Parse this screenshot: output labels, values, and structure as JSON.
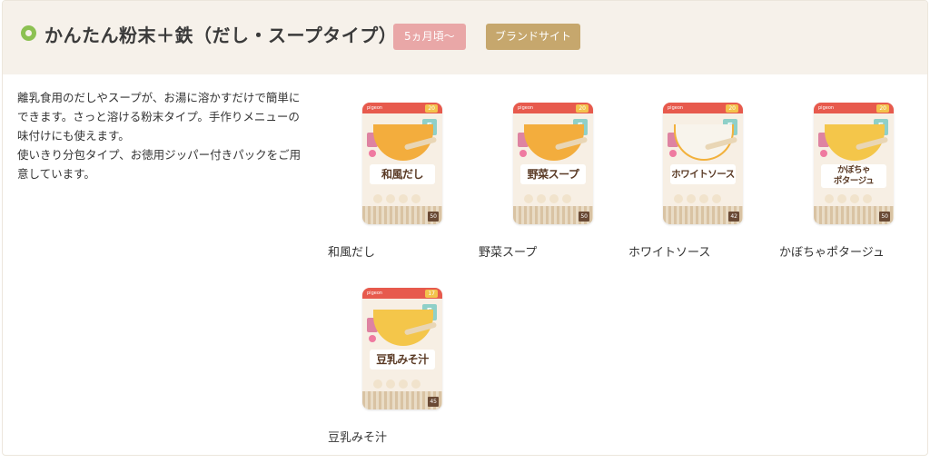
{
  "header": {
    "title": "かんたん粉末＋鉄（だし・スープタイプ）",
    "age_badge": "5ヵ月頃〜",
    "brand_button": "ブランドサイト"
  },
  "description": {
    "paragraph1": "離乳食用のだしやスープが、お湯に溶かすだけで簡単にできます。さっと溶ける粉末タイプ。手作りメニューの味付けにも使えます。",
    "paragraph2": "使いきり分包タイプ、お徳用ジッパー付きパックをご用意しています。"
  },
  "products": [
    {
      "name": "和風だし",
      "pack_label": "和風だし",
      "pack_count": "20",
      "pack_month": "5",
      "pack_grams": "50",
      "bowl": "orange"
    },
    {
      "name": "野菜スープ",
      "pack_label": "野菜スープ",
      "pack_count": "20",
      "pack_month": "5",
      "pack_grams": "50",
      "bowl": "orange"
    },
    {
      "name": "ホワイトソース",
      "pack_label": "ホワイトソース",
      "pack_count": "20",
      "pack_month": "5",
      "pack_grams": "42",
      "bowl": "white"
    },
    {
      "name": "かぼちゃポタージュ",
      "pack_label_line1": "かぼちゃ",
      "pack_label_line2": "ポタージュ",
      "pack_count": "20",
      "pack_month": "5",
      "pack_grams": "50",
      "bowl": "yellow"
    },
    {
      "name": "豆乳みそ汁",
      "pack_label": "豆乳みそ汁",
      "pack_count": "17",
      "pack_month": "5",
      "pack_grams": "45",
      "bowl": "yellow"
    }
  ],
  "pack_brand": "pigeon",
  "colors": {
    "header_bg": "#f6f1ea",
    "age_badge": "#e9a7a7",
    "brand_button": "#c6a76d",
    "dot": "#8cc152"
  }
}
